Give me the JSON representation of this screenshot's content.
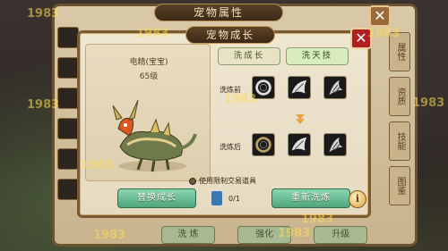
{
  "outer_window": {
    "title": "宠物属性",
    "close_glyph": "✕",
    "right_tabs": [
      "属性",
      "资质",
      "技能",
      "图鉴"
    ],
    "bottom_tabs": [
      "洗 炼",
      "强化",
      "升级"
    ]
  },
  "dialog": {
    "title": "宠物成长",
    "close_glyph": "✕",
    "pet": {
      "name": "电精(宝宝)",
      "level": "65级"
    },
    "tabs": [
      {
        "label": "洗成长",
        "state": "inactive"
      },
      {
        "label": "洗天技",
        "state": "active"
      }
    ],
    "before_label": "洗炼前",
    "after_label": "洗炼后",
    "checkbox_label": "使用限制交易道具",
    "replace_button": "替换成长",
    "rewash_button": "重新洗炼",
    "item_count": "0/1",
    "info_glyph": "i"
  },
  "watermarks": [
    "1983",
    "1983",
    "1983",
    "1983",
    "1983",
    "1983",
    "1983",
    "1983",
    "1983",
    "1983"
  ],
  "colors": {
    "dialog_border": "#7a5a32",
    "button_green": "#4fa57a",
    "close_red": "#b02020"
  }
}
